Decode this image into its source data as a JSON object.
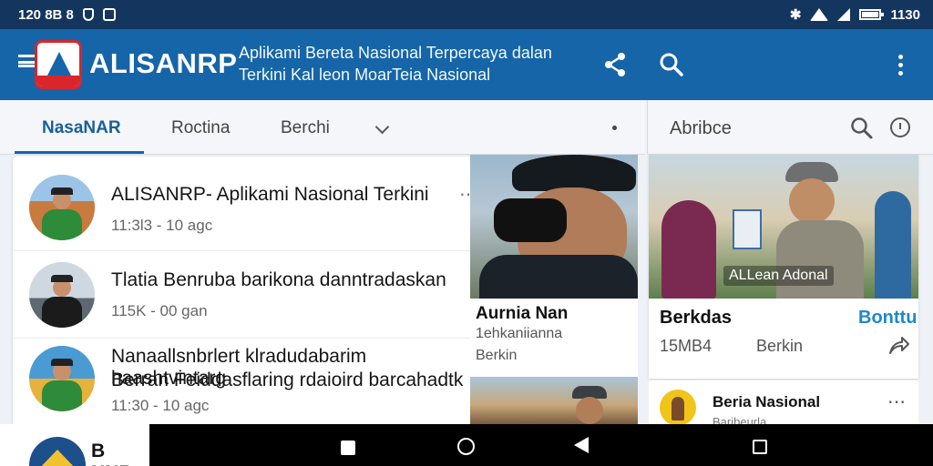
{
  "status_bar": {
    "left_text": "120 8B 8",
    "time": "1130",
    "battery_level": 1.0
  },
  "app_bar": {
    "app_name": "ALISANRP",
    "tagline_line1": "Aplikami Bereta Nasional Terpercaya dalan",
    "tagline_line2": "Terkini Kal leon MoarTeia Nasional",
    "icons": [
      "menu-icon",
      "logo",
      "share-icon",
      "search-icon",
      "more-vert-icon"
    ]
  },
  "tabs": [
    {
      "label": "NasaNAR",
      "active": true
    },
    {
      "label": "Roctina",
      "active": false
    },
    {
      "label": "Berchi",
      "active": false
    }
  ],
  "right_panel": {
    "title": "Abribce"
  },
  "news_list": [
    {
      "headline": "ALISANRP- Aplikami Nasional Terkini",
      "meta": "11:3l3 - 10  agc"
    },
    {
      "headline": "Tlatia Benruba barikona danntradaskan",
      "meta": "115K - 00  gan"
    },
    {
      "headline_line1": "Nanaallsnbrlert klradudabarim haashtvintarg",
      "headline_line2": "Berran Feiddasflaring rdaioird barcahadtk",
      "meta": "11:30 - 10  agc"
    }
  ],
  "photo_card": {
    "title": "Aurnia Nan",
    "subtitle": "1ehkaniianna",
    "source": "Berkin"
  },
  "right_card": {
    "overlay_label": "ALLean Adonal",
    "title": "Berkdas",
    "link": "Bonttu",
    "meta_left": "15MB4",
    "meta_right": "Berkin"
  },
  "right_card2": {
    "name": "Beria Nasional",
    "sub": "Baribeurla"
  },
  "partial_item": {
    "text": "B NNR"
  },
  "colors": {
    "primary": "#1565a8",
    "status_bar": "#14365e",
    "accent_link": "#1e88c9"
  }
}
